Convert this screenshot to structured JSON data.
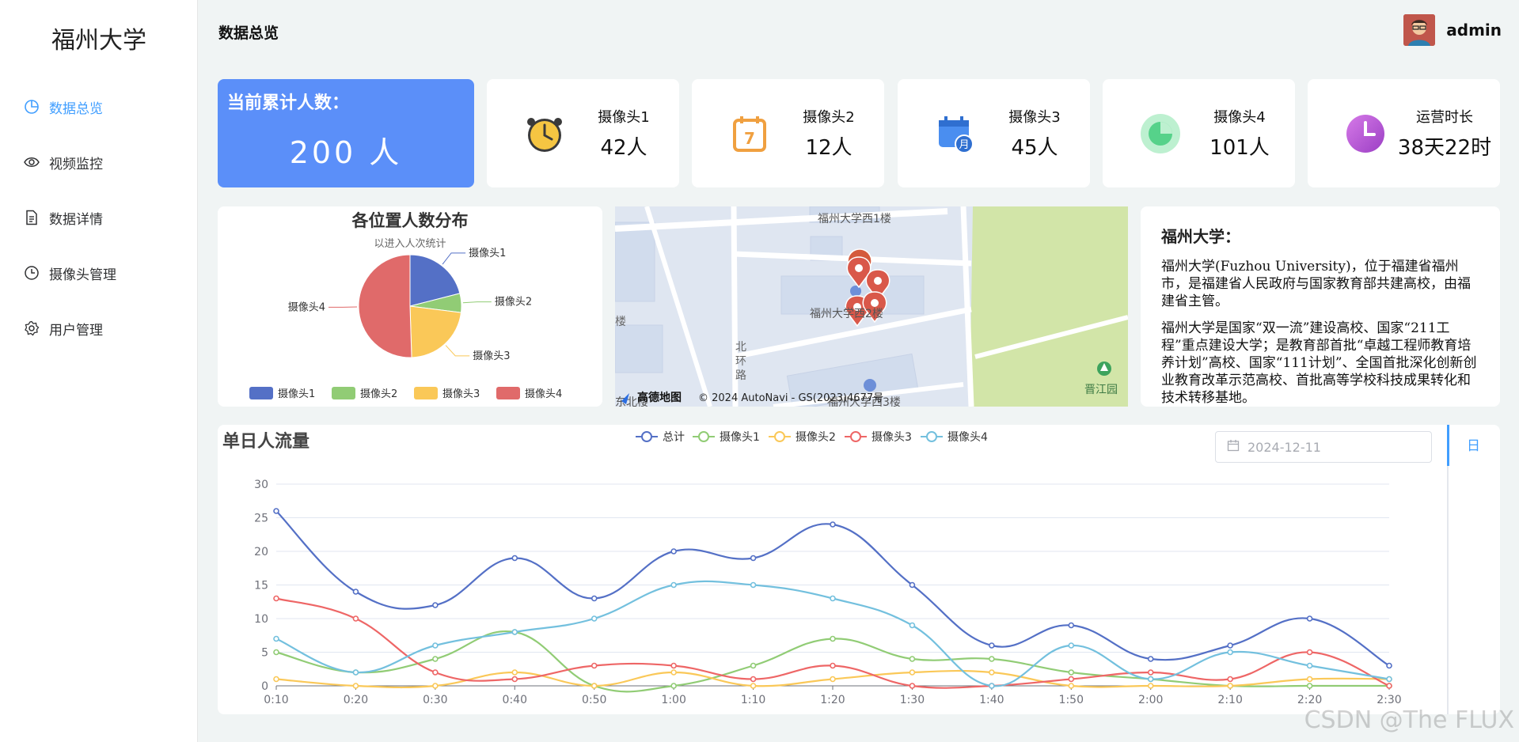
{
  "app": {
    "logo": "福州大学"
  },
  "sidebar": {
    "items": [
      {
        "label": "数据总览",
        "icon": "pie-chart-icon",
        "active": true
      },
      {
        "label": "视频监控",
        "icon": "eye-icon"
      },
      {
        "label": "数据详情",
        "icon": "document-icon"
      },
      {
        "label": "摄像头管理",
        "icon": "clock-icon"
      },
      {
        "label": "用户管理",
        "icon": "gear-icon"
      }
    ]
  },
  "header": {
    "title": "数据总览",
    "username": "admin",
    "avatar_icon": "user-avatar-icon"
  },
  "total": {
    "label": "当前累计人数：",
    "value": "200 人"
  },
  "stats": [
    {
      "name": "摄像头1",
      "value": "42人",
      "icon": "alarm-clock-icon",
      "color": "#f5c542"
    },
    {
      "name": "摄像头2",
      "value": "12人",
      "icon": "calendar-7-icon",
      "color": "#f0a040"
    },
    {
      "name": "摄像头3",
      "value": "45人",
      "icon": "calendar-month-icon",
      "color": "#4a8ef0"
    },
    {
      "name": "摄像头4",
      "value": "101人",
      "icon": "pie-badge-icon",
      "color": "#56d28a"
    },
    {
      "name": "运营时长",
      "value": "38天22时",
      "icon": "clock-purple-icon",
      "color": "#b34fd6"
    }
  ],
  "map": {
    "labels": [
      "福州大学西1楼",
      "福州大学西2楼",
      "北",
      "环",
      "路",
      "晋江园",
      "楼",
      "福州大学西3楼",
      "东北楼"
    ],
    "attribution": "© 2024 AutoNavi - GS(2023)4677号",
    "brand": "高德地图"
  },
  "info": {
    "title": "福州大学：",
    "paragraphs": [
      "福州大学(Fuzhou University)，位于福建省福州市，是福建省人民政府与国家教育部共建高校，由福建省主管。",
      "福州大学是国家“双一流”建设高校、国家“211工程”重点建设大学；是教育部首批“卓越工程师教育培养计划”高校、国家“111计划”、全国首批深化创新创业教育改革示范高校、首批高等学校科技成果转化和技术转移基地。"
    ]
  },
  "daily": {
    "title": "单日人流量",
    "date_value": "2024-12-11",
    "tab_label": "日",
    "calendar_icon": "calendar-icon"
  },
  "colors": {
    "primary": "#409eff",
    "total_card": "#5b8ff9",
    "series": [
      "#5470c6",
      "#91cc75",
      "#fac858",
      "#ee6666",
      "#73c0de"
    ],
    "pie": [
      "#5470c6",
      "#91cc75",
      "#fac858",
      "#e06a6a"
    ]
  },
  "chart_data": [
    {
      "type": "pie",
      "title": "各位置人数分布",
      "subtitle": "以进入人次统计",
      "categories": [
        "摄像头1",
        "摄像头2",
        "摄像头3",
        "摄像头4"
      ],
      "values": [
        42,
        12,
        45,
        101
      ],
      "legend": "bottom"
    },
    {
      "type": "line",
      "title": "单日人流量",
      "x": [
        "0:10",
        "0:20",
        "0:30",
        "0:40",
        "0:50",
        "1:00",
        "1:10",
        "1:20",
        "1:30",
        "1:40",
        "1:50",
        "2:00",
        "2:10",
        "2:20",
        "2:30"
      ],
      "ylim": [
        0,
        30
      ],
      "yticks": [
        0,
        5,
        10,
        15,
        20,
        25,
        30
      ],
      "grid": true,
      "legend": "top-center",
      "series": [
        {
          "name": "总计",
          "values": [
            26,
            14,
            12,
            19,
            13,
            20,
            19,
            24,
            15,
            6,
            9,
            4,
            6,
            10,
            3
          ]
        },
        {
          "name": "摄像头1",
          "values": [
            5,
            2,
            4,
            8,
            0,
            0,
            3,
            7,
            4,
            4,
            2,
            1,
            0,
            0,
            0
          ]
        },
        {
          "name": "摄像头2",
          "values": [
            1,
            0,
            0,
            2,
            0,
            2,
            0,
            1,
            2,
            2,
            0,
            0,
            0,
            1,
            1
          ]
        },
        {
          "name": "摄像头3",
          "values": [
            13,
            10,
            2,
            1,
            3,
            3,
            1,
            3,
            0,
            0,
            1,
            2,
            1,
            5,
            0
          ]
        },
        {
          "name": "摄像头4",
          "values": [
            7,
            2,
            6,
            8,
            10,
            15,
            15,
            13,
            9,
            0,
            6,
            1,
            5,
            3,
            1
          ]
        }
      ]
    }
  ],
  "watermark": "CSDN @The FLUX"
}
